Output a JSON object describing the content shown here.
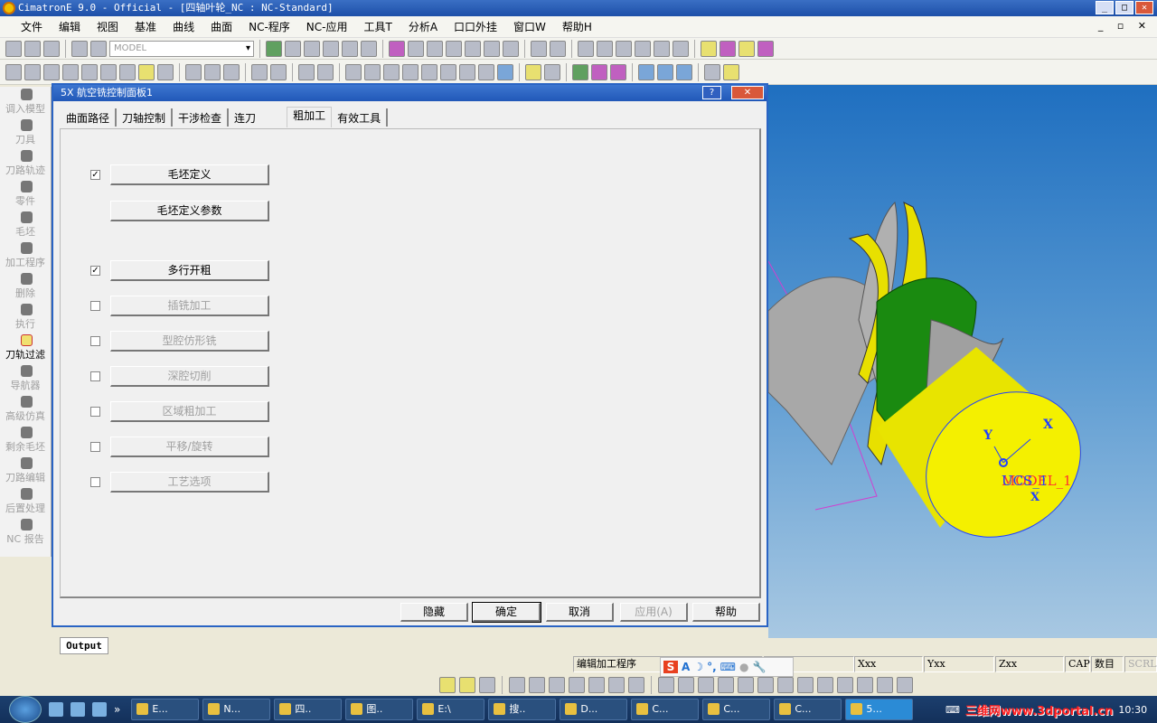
{
  "window": {
    "title": "CimatronE 9.0 - Official - [四轴叶轮_NC : NC-Standard]"
  },
  "menu": [
    "文件",
    "编辑",
    "视图",
    "基准",
    "曲线",
    "曲面",
    "NC-程序",
    "NC-应用",
    "工具T",
    "分析A",
    "口口外挂",
    "窗口W",
    "帮助H"
  ],
  "toolbar": {
    "model_combo": "MODEL"
  },
  "sidebar": [
    {
      "label": "调入模型",
      "active": false
    },
    {
      "label": "刀具",
      "active": false
    },
    {
      "label": "刀路轨迹",
      "active": false
    },
    {
      "label": "零件",
      "active": false
    },
    {
      "label": "毛坯",
      "active": false
    },
    {
      "label": "加工程序",
      "active": false
    },
    {
      "label": "删除",
      "active": false
    },
    {
      "label": "执行",
      "active": false
    },
    {
      "label": "刀轨过滤",
      "active": true
    },
    {
      "label": "导航器",
      "active": false
    },
    {
      "label": "高级仿真",
      "active": false
    },
    {
      "label": "剩余毛坯",
      "active": false
    },
    {
      "label": "刀路编辑",
      "active": false
    },
    {
      "label": "后置处理",
      "active": false
    },
    {
      "label": "NC 报告",
      "active": false
    }
  ],
  "dialog": {
    "title": "5X 航空铣控制面板1",
    "help_btn": "?",
    "close_btn": "✕",
    "tabs": [
      {
        "label": "曲面路径"
      },
      {
        "label": "刀轴控制"
      },
      {
        "label": "干涉检查"
      },
      {
        "label": "连刀"
      },
      {
        "label": "粗加工",
        "selected": true
      },
      {
        "label": "有效工具"
      }
    ],
    "options": [
      {
        "label": "毛坯定义",
        "checkbox": true,
        "checked": true,
        "enabled": true
      },
      {
        "label": "毛坯定义参数",
        "checkbox": false,
        "checked": false,
        "enabled": true
      },
      {
        "label": "多行开粗",
        "checkbox": true,
        "checked": true,
        "enabled": true
      },
      {
        "label": "插铣加工",
        "checkbox": true,
        "checked": false,
        "enabled": false
      },
      {
        "label": "型腔仿形铣",
        "checkbox": true,
        "checked": false,
        "enabled": false
      },
      {
        "label": "深腔切削",
        "checkbox": true,
        "checked": false,
        "enabled": false
      },
      {
        "label": "区域粗加工",
        "checkbox": true,
        "checked": false,
        "enabled": false
      },
      {
        "label": "平移/旋转",
        "checkbox": true,
        "checked": false,
        "enabled": false
      },
      {
        "label": "工艺选项",
        "checkbox": true,
        "checked": false,
        "enabled": false
      }
    ],
    "buttons": {
      "hide": "隐藏",
      "ok": "确定",
      "cancel": "取消",
      "apply": "应用(A)",
      "help": "帮助"
    }
  },
  "viewport": {
    "axis_x": "X",
    "axis_y": "Y",
    "axis_x2": "X",
    "ucs_label": "UCS_1",
    "model_label": "MODEL_1"
  },
  "output_tab": "Output",
  "status": {
    "mode": "编辑加工程序",
    "x": "Xxx",
    "y": "Yxx",
    "z": "Zxx",
    "cap": "CAP",
    "num": "数目",
    "scrl": "SCRL"
  },
  "taskbar": {
    "more": "»",
    "tasks": [
      {
        "label": "E..."
      },
      {
        "label": "N..."
      },
      {
        "label": "四.."
      },
      {
        "label": "图.."
      },
      {
        "label": "E:\\"
      },
      {
        "label": "搜.."
      },
      {
        "label": "D..."
      },
      {
        "label": "C..."
      },
      {
        "label": "C..."
      },
      {
        "label": "C..."
      },
      {
        "label": "5...",
        "active": true
      }
    ],
    "watermark": "三维网www.3dportal.cn",
    "clock": "10:30"
  }
}
